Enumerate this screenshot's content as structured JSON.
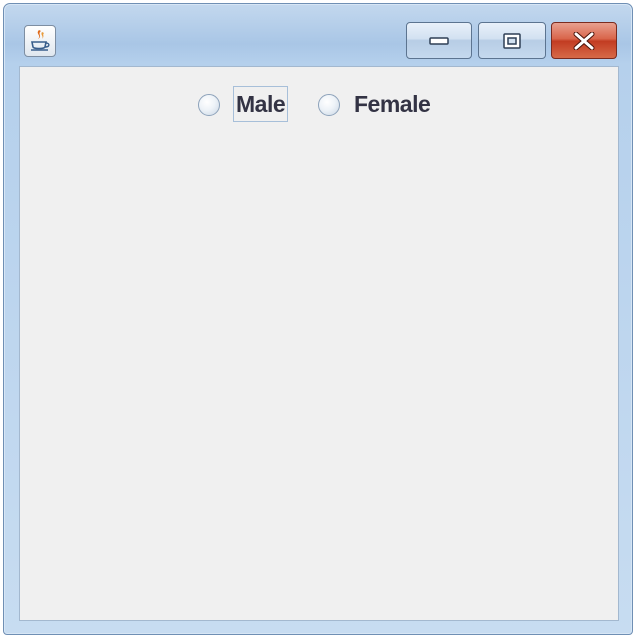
{
  "window": {
    "title": "",
    "controls": {
      "minimize": "minimize-icon",
      "maximize": "maximize-icon",
      "close": "close-icon"
    },
    "app_icon": "java-cup-icon"
  },
  "gender": {
    "options": [
      {
        "label": "Male",
        "selected": false,
        "focused": true
      },
      {
        "label": "Female",
        "selected": false,
        "focused": false
      }
    ]
  },
  "colors": {
    "close_button": "#c23c22",
    "client_background": "#f0f0f0"
  }
}
